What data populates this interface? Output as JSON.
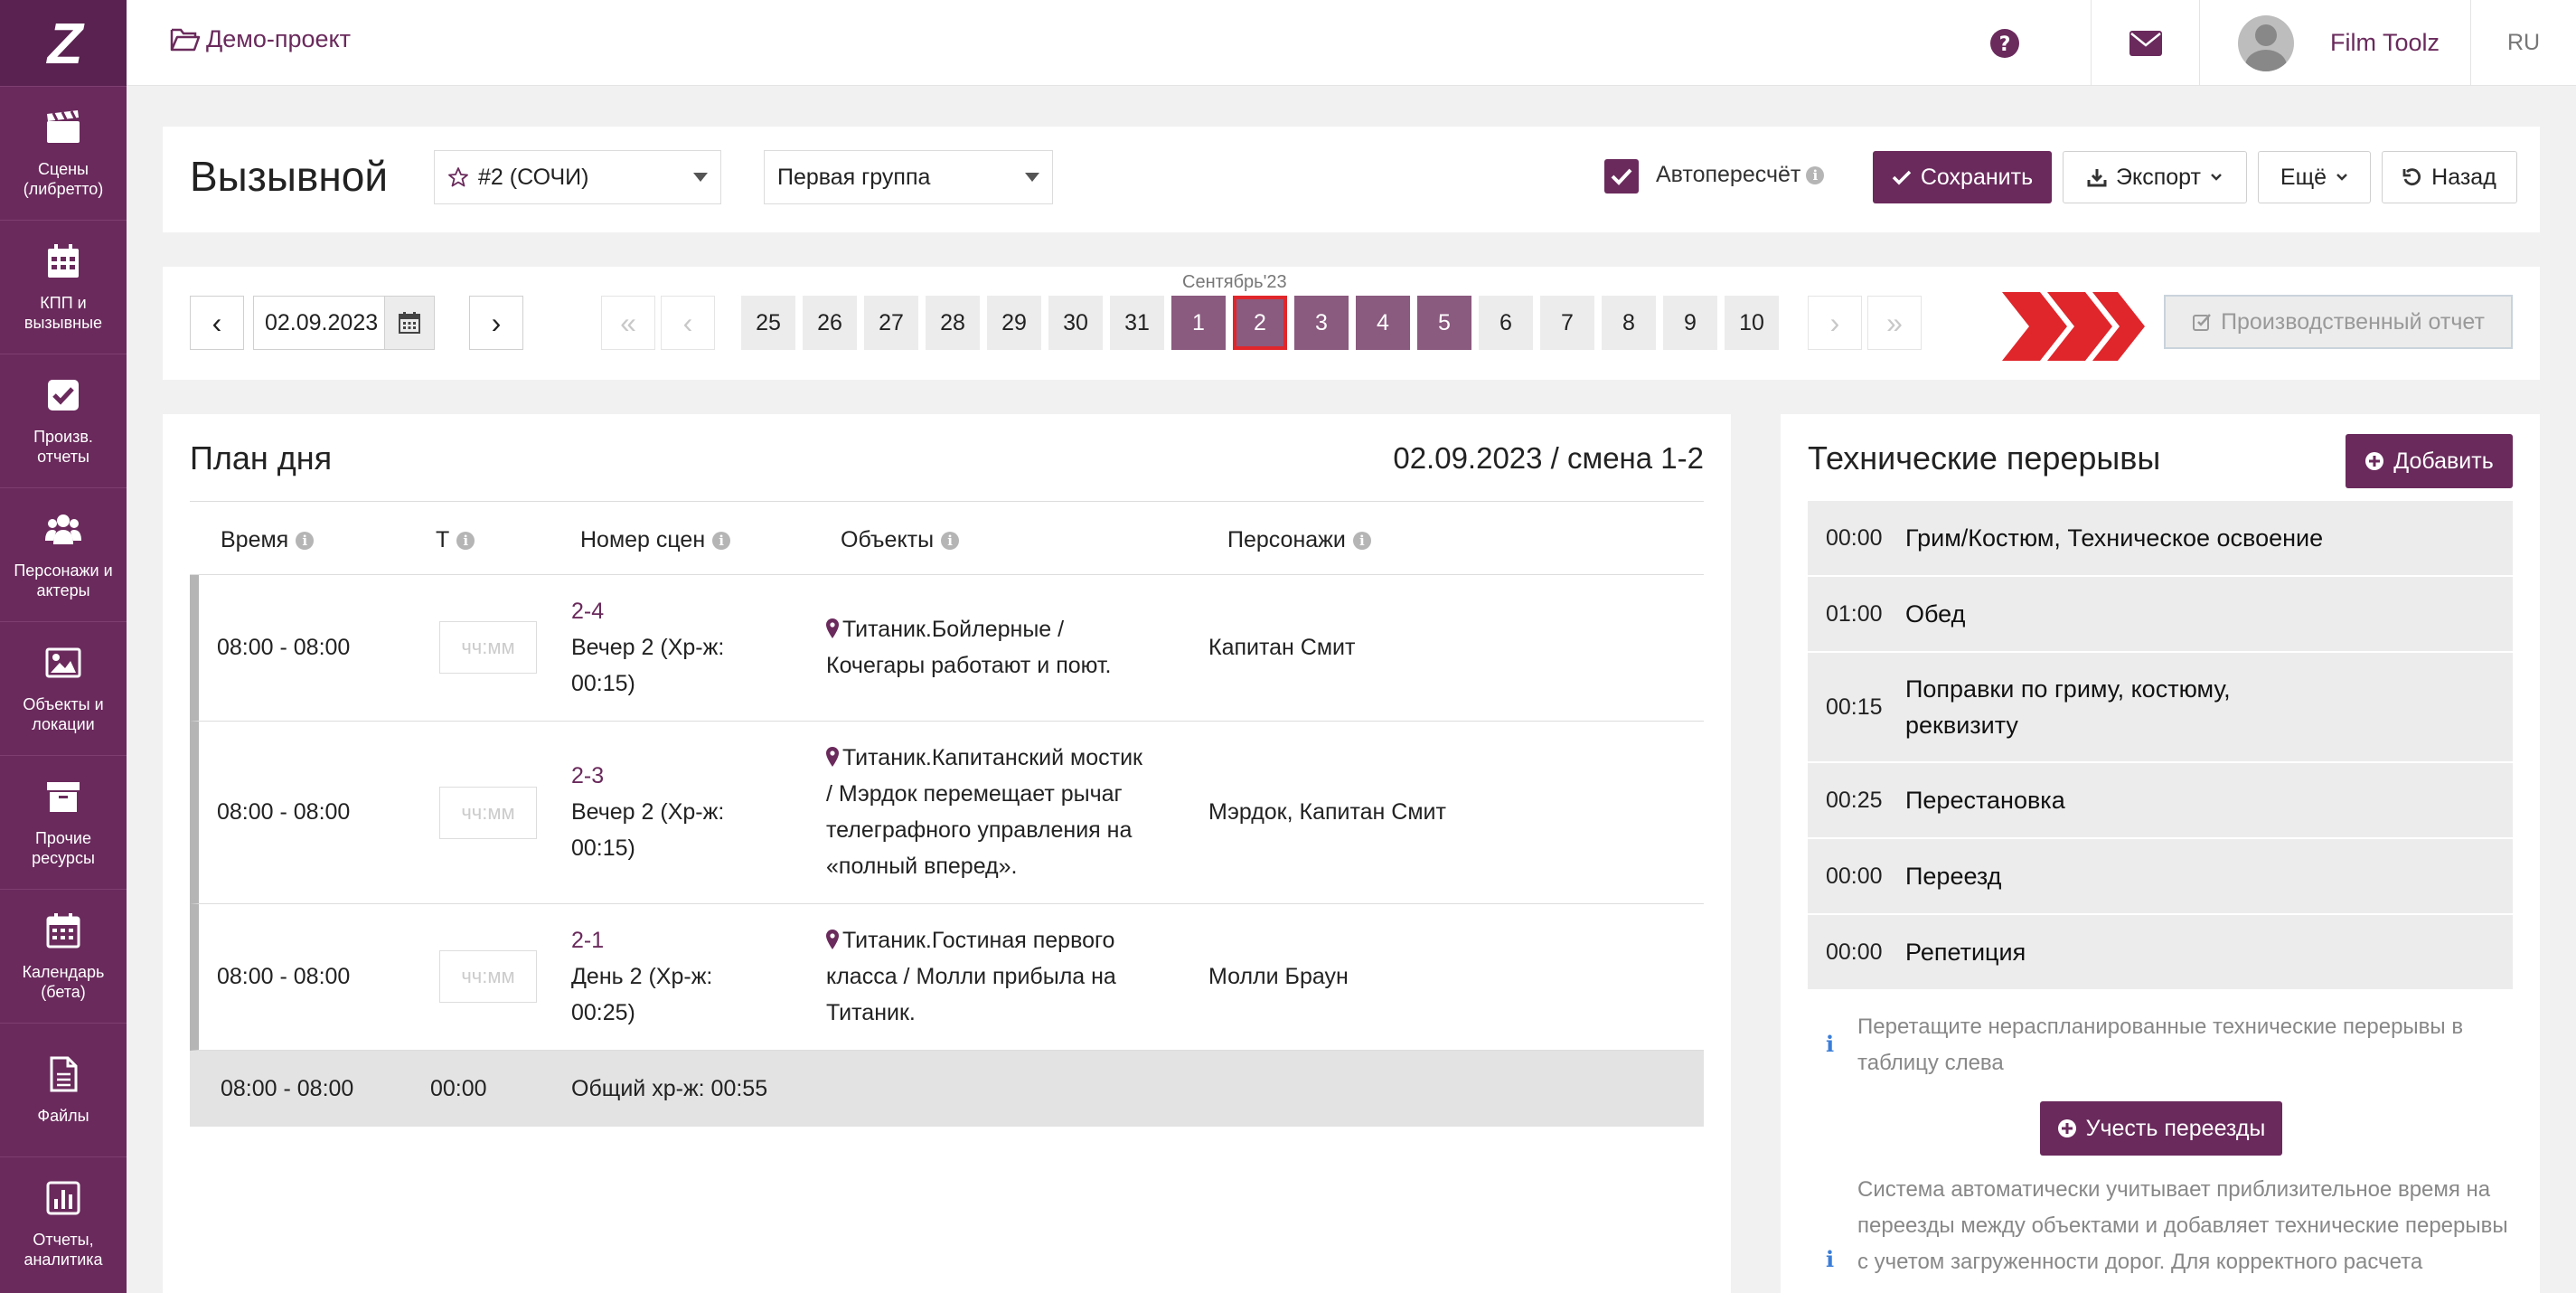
{
  "sidebar": {
    "logo": "Z",
    "items": [
      {
        "label": "Сцены (либретто)",
        "icon": "clapperboard-icon"
      },
      {
        "label": "КПП и вызывные",
        "icon": "calendar-grid-icon"
      },
      {
        "label": "Произв. отчеты",
        "icon": "checkbox-icon"
      },
      {
        "label": "Персонажи и актеры",
        "icon": "users-icon"
      },
      {
        "label": "Объекты и локации",
        "icon": "image-icon"
      },
      {
        "label": "Прочие ресурсы",
        "icon": "archive-box-icon"
      },
      {
        "label": "Календарь (бета)",
        "icon": "calendar-icon"
      },
      {
        "label": "Файлы",
        "icon": "file-icon"
      },
      {
        "label": "Отчеты, аналитика",
        "icon": "bar-chart-icon"
      }
    ]
  },
  "topbar": {
    "project": "Демо-проект",
    "user": "Film Toolz",
    "lang": "RU"
  },
  "header": {
    "title": "Вызывной",
    "project_select": "#2 (СОЧИ)",
    "group_select": "Первая группа",
    "auto_recalc_label": "Автопересчёт",
    "auto_recalc_checked": true,
    "save": "Сохранить",
    "export": "Экспорт",
    "more": "Ещё",
    "back": "Назад"
  },
  "dates": {
    "current_date": "02.09.2023",
    "month_label": "Сентябрь'23",
    "days": [
      {
        "label": "25",
        "state": "normal"
      },
      {
        "label": "26",
        "state": "normal"
      },
      {
        "label": "27",
        "state": "normal"
      },
      {
        "label": "28",
        "state": "normal"
      },
      {
        "label": "29",
        "state": "normal"
      },
      {
        "label": "30",
        "state": "normal"
      },
      {
        "label": "31",
        "state": "normal"
      },
      {
        "label": "1",
        "state": "active"
      },
      {
        "label": "2",
        "state": "selected"
      },
      {
        "label": "3",
        "state": "active"
      },
      {
        "label": "4",
        "state": "active"
      },
      {
        "label": "5",
        "state": "active"
      },
      {
        "label": "6",
        "state": "normal"
      },
      {
        "label": "7",
        "state": "normal"
      },
      {
        "label": "8",
        "state": "normal"
      },
      {
        "label": "9",
        "state": "normal"
      },
      {
        "label": "10",
        "state": "normal"
      }
    ],
    "production_report": "Производственный отчет",
    "accent": "#e0262b"
  },
  "plan": {
    "title": "План дня",
    "date_shift": "02.09.2023 / смена 1-2",
    "columns": [
      "Время",
      "Т",
      "Номер сцен",
      "Объекты",
      "Персонажи"
    ],
    "time_placeholder": "чч:мм",
    "rows": [
      {
        "time": "08:00 - 08:00",
        "scene": "2-4",
        "scene_desc": [
          "Вечер 2 (Хр-ж:",
          "00:15)"
        ],
        "object": [
          "Титаник.Бойлерные /",
          "Кочегары работают и поют."
        ],
        "characters": "Капитан Смит"
      },
      {
        "time": "08:00 - 08:00",
        "scene": "2-3",
        "scene_desc": [
          "Вечер 2 (Хр-ж:",
          "00:15)"
        ],
        "object": [
          "Титаник.Капитанский мостик",
          "/ Мэрдок перемещает рычаг",
          "телеграфного управления на",
          "«полный вперед»."
        ],
        "characters": "Мэрдок, Капитан Смит"
      },
      {
        "time": "08:00 - 08:00",
        "scene": "2-1",
        "scene_desc": [
          "День 2 (Хр-ж:",
          "00:25)"
        ],
        "object": [
          "Титаник.Гостиная первого",
          "класса / Молли прибыла на",
          "Титаник."
        ],
        "characters": "Молли Браун"
      }
    ],
    "footer": {
      "time": "08:00 - 08:00",
      "t": "00:00",
      "total": "Общий хр-ж: 00:55"
    }
  },
  "tech": {
    "title": "Технические перерывы",
    "add": "Добавить",
    "items": [
      {
        "time": "00:00",
        "name": [
          "Грим/Костюм, Техническое освоение"
        ]
      },
      {
        "time": "01:00",
        "name": [
          "Обед"
        ]
      },
      {
        "time": "00:15",
        "name": [
          "Поправки по гриму, костюму,",
          "реквизиту"
        ]
      },
      {
        "time": "00:25",
        "name": [
          "Перестановка"
        ]
      },
      {
        "time": "00:00",
        "name": [
          "Переезд"
        ]
      },
      {
        "time": "00:00",
        "name": [
          "Репетиция"
        ]
      }
    ],
    "drag_note": [
      "Перетащите нераспланированные технические перерывы в",
      "таблицу слева"
    ],
    "travel_button": "Учесть переезды",
    "auto_note": [
      "Система автоматически учитывает приблизительное время на",
      "переезды между объектами и добавляет технические перерывы",
      "с учетом загруженности дорог. Для корректного расчета"
    ]
  },
  "colors": {
    "brand": "#6a2a5c",
    "day_active": "#8a5a7f"
  }
}
